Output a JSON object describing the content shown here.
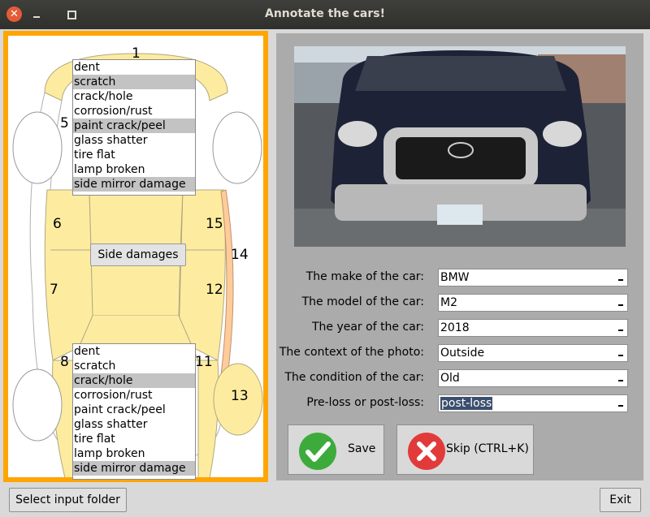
{
  "window": {
    "title": "Annotate the cars!"
  },
  "diagram": {
    "numbers": {
      "n1": "1",
      "n5": "5",
      "n6": "6",
      "n7": "7",
      "n8": "8",
      "n11": "11",
      "n12": "12",
      "n13": "13",
      "n14": "14",
      "n15": "15"
    },
    "side_button": "Side damages",
    "top_list": [
      {
        "label": "dent",
        "selected": false
      },
      {
        "label": "scratch",
        "selected": true
      },
      {
        "label": "crack/hole",
        "selected": false
      },
      {
        "label": "corrosion/rust",
        "selected": false
      },
      {
        "label": "paint crack/peel",
        "selected": true
      },
      {
        "label": "glass shatter",
        "selected": false
      },
      {
        "label": "tire flat",
        "selected": false
      },
      {
        "label": "lamp broken",
        "selected": false
      },
      {
        "label": "side mirror damage",
        "selected": true
      }
    ],
    "bottom_list": [
      {
        "label": "dent",
        "selected": false
      },
      {
        "label": "scratch",
        "selected": false
      },
      {
        "label": "crack/hole",
        "selected": true
      },
      {
        "label": "corrosion/rust",
        "selected": false
      },
      {
        "label": "paint crack/peel",
        "selected": false
      },
      {
        "label": "glass shatter",
        "selected": false
      },
      {
        "label": "tire flat",
        "selected": false
      },
      {
        "label": "lamp broken",
        "selected": false
      },
      {
        "label": "side mirror damage",
        "selected": true
      }
    ]
  },
  "form": {
    "make": {
      "label": "The make of the car:",
      "value": "BMW"
    },
    "model": {
      "label": "The model of the car:",
      "value": "M2"
    },
    "year": {
      "label": "The year of the car:",
      "value": "2018"
    },
    "context": {
      "label": "The context of the photo:",
      "value": "Outside"
    },
    "condition": {
      "label": "The condition of the car:",
      "value": "Old"
    },
    "loss": {
      "label": "Pre-loss or post-loss:",
      "value": "post-loss"
    }
  },
  "actions": {
    "save": "Save",
    "skip": "Skip (CTRL+K)"
  },
  "footer": {
    "select_folder": "Select input folder",
    "exit": "Exit"
  },
  "icons": {
    "close": "close-icon",
    "minimize": "minimize-icon",
    "maximize": "maximize-icon",
    "save": "checkmark-icon",
    "skip": "x-icon"
  },
  "colors": {
    "highlight": "#ffa500",
    "damage_zone": "#fdeca0",
    "zone_14": "#ffcc99",
    "save_green": "#3cab3c",
    "skip_red": "#e23a3a"
  }
}
